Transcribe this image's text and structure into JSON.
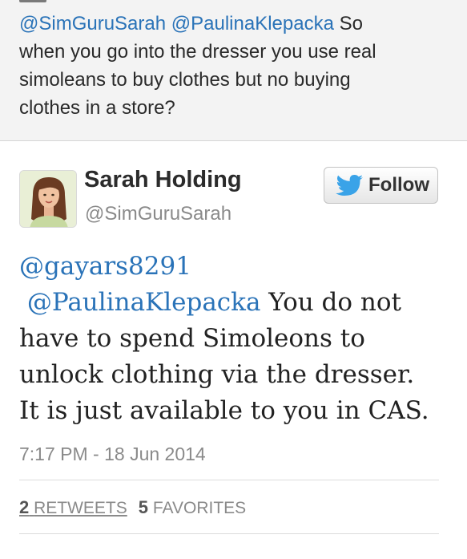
{
  "parent_tweet": {
    "mention_1": "@SimGuruSarah",
    "mention_2": "@PaulinaKlepacka",
    "text_line_1_rest": "So",
    "text_line_2": "when you go into the dresser you use real",
    "text_line_3": "simoleans to buy clothes but no buying",
    "text_line_4": "clothes in a store?"
  },
  "tweet": {
    "author_name": "Sarah Holding",
    "author_handle": "@SimGuruSarah",
    "follow_label": "Follow",
    "body": {
      "mention_1": "@gayars8291",
      "mention_2": "@PaulinaKlepacka",
      "line_2_rest": "You do not",
      "line_3": "have to spend Simoleons to",
      "line_4": "unlock clothing via the dresser.",
      "line_5": "It is just available to you in CAS."
    },
    "timestamp": "7:17 PM - 18 Jun 2014",
    "retweets_count": "2",
    "retweets_label": "RETWEETS",
    "favorites_count": "5",
    "favorites_label": "FAVORITES"
  },
  "colors": {
    "link": "#2a73b8",
    "twitter_bird": "#3aa3e8",
    "background_parent": "#f3f3f3"
  },
  "icons": {
    "follow": "twitter-bird-icon",
    "avatar": "user-avatar"
  }
}
